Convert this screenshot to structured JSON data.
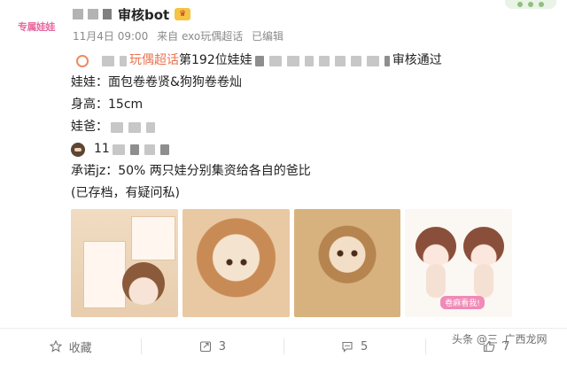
{
  "post": {
    "avatar_text": "专属娃娃",
    "username": "审核bot",
    "meta": {
      "date": "11月4日 09:00",
      "source": "来自 exo玩偶超话",
      "edited": "已编辑"
    },
    "content": {
      "line1": {
        "super_topic": "玩偶超话",
        "prefix": "第192位娃娃",
        "suffix": "审核通过"
      },
      "line2": "娃娃：面包卷卷贤&狗狗卷卷灿",
      "line3": "身高：15cm",
      "line4_label": "娃爸：",
      "line5_number": "11",
      "line6": "承诺jz：50% 两只娃分别集资给各自的爸比",
      "line7": "(已存档，有疑问私)"
    },
    "images": [
      {
        "name": "doll-info-card"
      },
      {
        "name": "curly-doll-photo"
      },
      {
        "name": "bear-hat-doll-photo"
      },
      {
        "name": "doll-design-sketch",
        "tag": "卷麻看我!"
      }
    ],
    "actions": {
      "favorite_label": "收藏",
      "repost_count": "3",
      "comment_count": "5",
      "like_count": "7"
    },
    "watermark": "头条 @三 .广西龙网"
  }
}
